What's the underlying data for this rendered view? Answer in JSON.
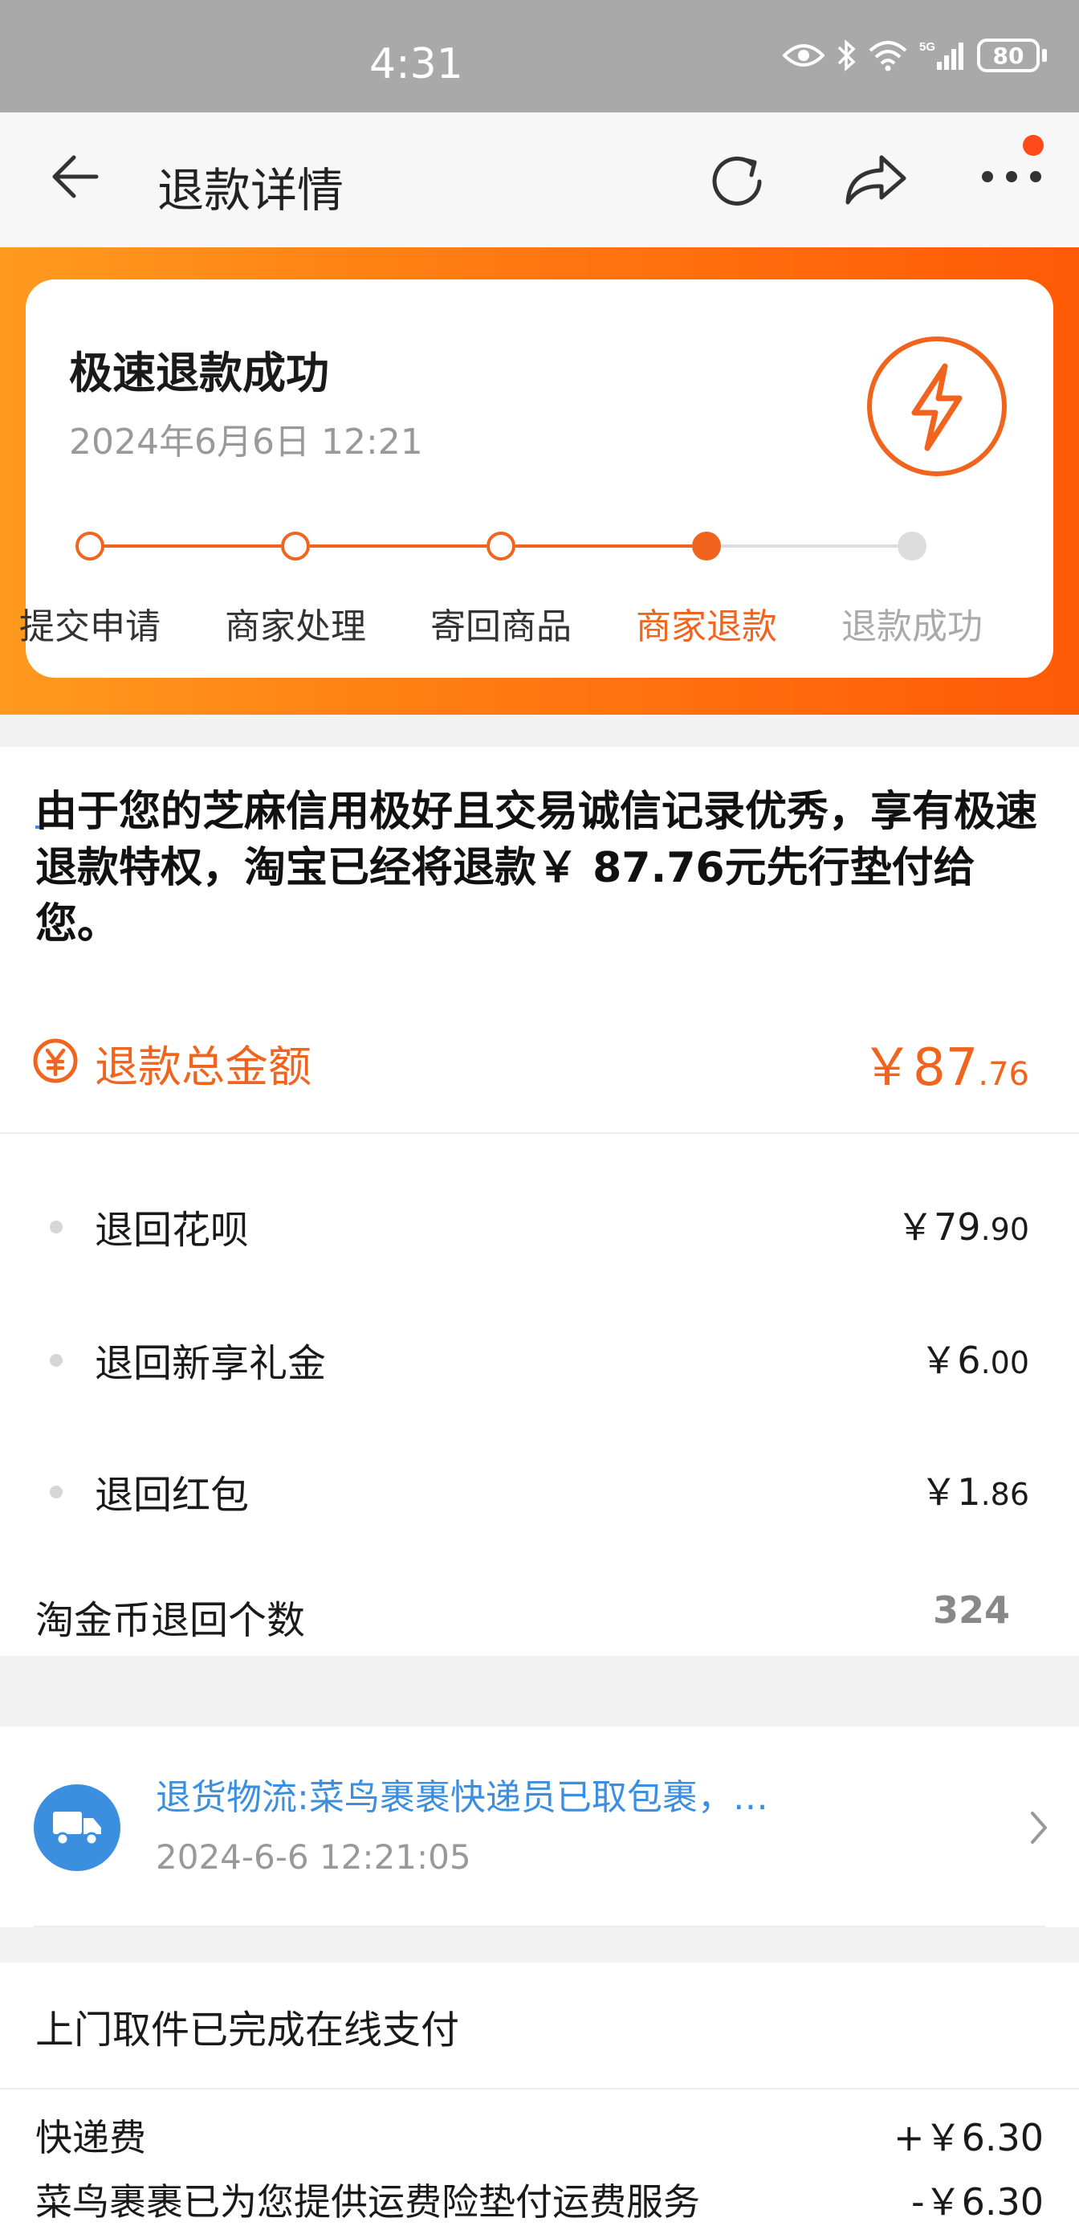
{
  "status_bar": {
    "time": "4:31",
    "battery": "80",
    "network": "5G"
  },
  "nav": {
    "title": "退款详情",
    "back_icon": "arrow-left-icon",
    "refresh_icon": "refresh-icon",
    "share_icon": "share-icon",
    "more_icon": "more-dots-icon"
  },
  "hero": {
    "title": "极速退款成功",
    "time": "2024年6月6日 12:21",
    "icon": "lightning-icon",
    "steps": [
      {
        "label": "提交申请",
        "state": "done"
      },
      {
        "label": "商家处理",
        "state": "done"
      },
      {
        "label": "寄回商品",
        "state": "done"
      },
      {
        "label": "商家退款",
        "state": "current"
      },
      {
        "label": "退款成功",
        "state": "pending"
      }
    ]
  },
  "notice": {
    "text": "由于您的芝麻信用极好且交易诚信记录优秀，享有极速退款特权，淘宝已经将退款￥ 87.76元先行垫付给您。"
  },
  "total": {
    "label": "退款总金额",
    "currency": "￥",
    "integer": "87",
    "decimal": ".76"
  },
  "details": [
    {
      "name": "退回花呗",
      "currency": "￥",
      "integer": "79",
      "decimal": ".90"
    },
    {
      "name": "退回新享礼金",
      "currency": "￥",
      "integer": "6",
      "decimal": ".00"
    },
    {
      "name": "退回红包",
      "currency": "￥",
      "integer": "1",
      "decimal": ".86"
    }
  ],
  "coins": {
    "name": "淘金币退回个数",
    "value": "324"
  },
  "logistics": {
    "info": "退货物流:菜鸟裹裹快递员已取包裹，…",
    "time": "2024-6-6 12:21:05"
  },
  "pickup": {
    "title": "上门取件已完成在线支付",
    "fees": [
      {
        "name": "快递费",
        "value": "+￥6.30"
      },
      {
        "name": "菜鸟裹裹已为您提供运费险垫付运费服务",
        "value": "-￥6.30"
      }
    ]
  },
  "colors": {
    "accent": "#f1641e",
    "blue": "#3c8fdf",
    "pending": "#dddddd"
  }
}
